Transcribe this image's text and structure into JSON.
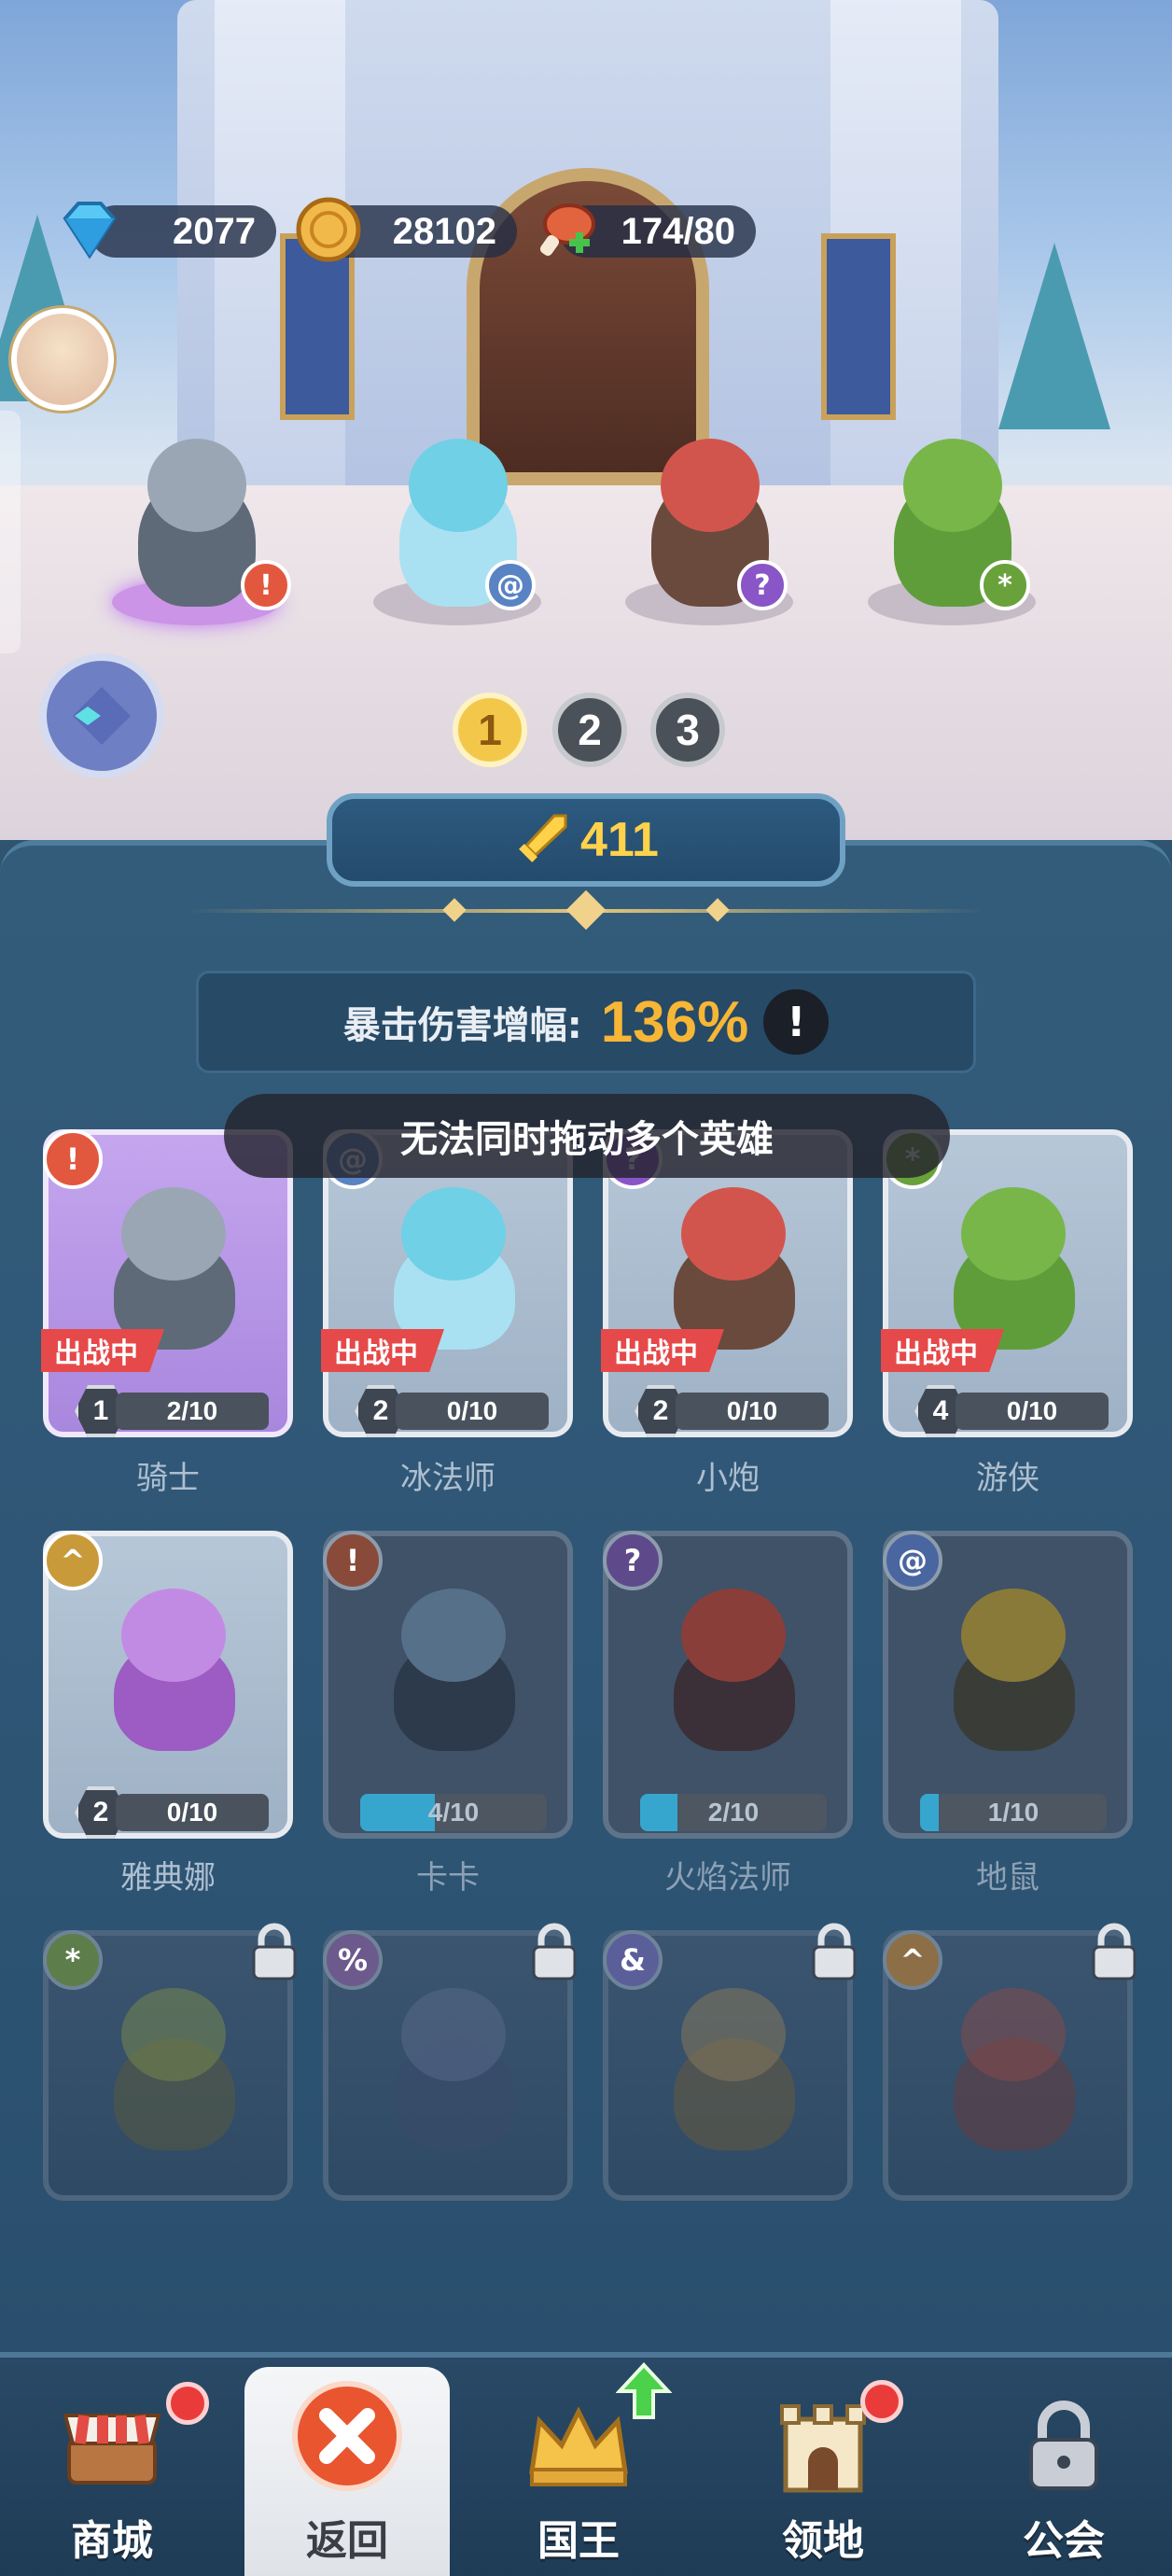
{
  "resources": {
    "gems": "2077",
    "coins": "28102",
    "stamina": "174/80"
  },
  "formation_pages": [
    "1",
    "2",
    "3"
  ],
  "active_page": "1",
  "power": "411",
  "stat": {
    "label": "暴击伤害增幅:",
    "value": "136%",
    "info": "!"
  },
  "toast": "无法同时拖动多个英雄",
  "deploy_tag": "出战中",
  "heroes": [
    {
      "name": "骑士",
      "level": "1",
      "shards": "2/10",
      "deployed": true,
      "selected": true,
      "class_color": "#e2583f"
    },
    {
      "name": "冰法师",
      "level": "2",
      "shards": "0/10",
      "deployed": true,
      "class_color": "#5a83c4"
    },
    {
      "name": "小炮",
      "level": "2",
      "shards": "0/10",
      "deployed": true,
      "class_color": "#8a55c7"
    },
    {
      "name": "游侠",
      "level": "4",
      "shards": "0/10",
      "deployed": true,
      "class_color": "#69a13b"
    },
    {
      "name": "雅典娜",
      "level": "2",
      "shards": "0/10",
      "deployed": false,
      "class_color": "#c99a3a"
    },
    {
      "name": "卡卡",
      "shards": "4/10",
      "progress": 0.4,
      "class_color": "#b3573f"
    },
    {
      "name": "火焰法师",
      "shards": "2/10",
      "progress": 0.2,
      "class_color": "#7a58b0"
    },
    {
      "name": "地鼠",
      "shards": "1/10",
      "progress": 0.1,
      "class_color": "#5a83c4"
    }
  ],
  "locked_heroes": [
    {
      "class_color": "#5d7d4a"
    },
    {
      "class_color": "#6c5a8c"
    },
    {
      "class_color": "#5a5f9a"
    },
    {
      "class_color": "#8c6f46"
    }
  ],
  "nav": [
    {
      "label": "商城",
      "badge": true
    },
    {
      "label": "返回",
      "active": true
    },
    {
      "label": "国王",
      "upgrade": true
    },
    {
      "label": "领地",
      "badge": true
    },
    {
      "label": "公会",
      "locked": true
    }
  ],
  "colors": {
    "accent_gold": "#f7b636",
    "deploy_red": "#e6494a",
    "panel_blue": "#2f5676"
  }
}
